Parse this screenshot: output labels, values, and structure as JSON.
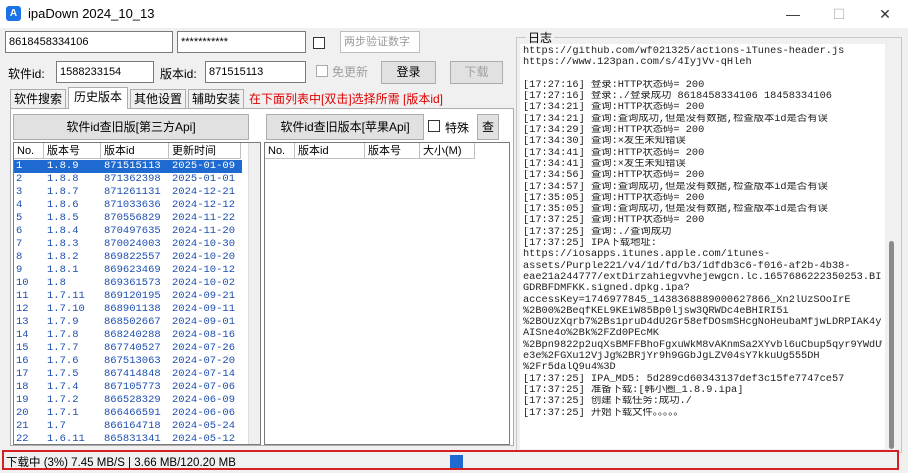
{
  "window": {
    "title": "ipaDown 2024_10_13",
    "icon_letter": "A",
    "minimize": "—",
    "maximize": "☐",
    "close": "✕"
  },
  "login": {
    "account": "8618458334106",
    "password": "***********",
    "twofa_placeholder": "两步验证数字",
    "software_id_label": "软件id:",
    "software_id": "1588233154",
    "version_id_label": "版本id:",
    "version_id": "871515113",
    "no_update_label": "免更新",
    "login_button": "登录",
    "download_button": "下载"
  },
  "tabs": [
    {
      "label": "软件搜索"
    },
    {
      "label": "历史版本"
    },
    {
      "label": "其他设置"
    },
    {
      "label": "辅助安装"
    }
  ],
  "hint": "在下面列表中[双击]选择所需 [版本id]",
  "left_panel": {
    "button": "软件id查旧版[第三方Api]",
    "columns": [
      "No.",
      "版本号",
      "版本id",
      "更新时间"
    ],
    "rows": [
      [
        "1",
        "1.8.9",
        "871515113",
        "2025-01-09"
      ],
      [
        "2",
        "1.8.8",
        "871362398",
        "2025-01-01"
      ],
      [
        "3",
        "1.8.7",
        "871261131",
        "2024-12-21"
      ],
      [
        "4",
        "1.8.6",
        "871033636",
        "2024-12-12"
      ],
      [
        "5",
        "1.8.5",
        "870556829",
        "2024-11-22"
      ],
      [
        "6",
        "1.8.4",
        "870497635",
        "2024-11-20"
      ],
      [
        "7",
        "1.8.3",
        "870024003",
        "2024-10-30"
      ],
      [
        "8",
        "1.8.2",
        "869822557",
        "2024-10-20"
      ],
      [
        "9",
        "1.8.1",
        "869623469",
        "2024-10-12"
      ],
      [
        "10",
        "1.8",
        "869361573",
        "2024-10-02"
      ],
      [
        "11",
        "1.7.11",
        "869120195",
        "2024-09-21"
      ],
      [
        "12",
        "1.7.10",
        "868901138",
        "2024-09-11"
      ],
      [
        "13",
        "1.7.9",
        "868502667",
        "2024-09-01"
      ],
      [
        "14",
        "1.7.8",
        "868240288",
        "2024-08-16"
      ],
      [
        "15",
        "1.7.7",
        "867740527",
        "2024-07-26"
      ],
      [
        "16",
        "1.7.6",
        "867513063",
        "2024-07-20"
      ],
      [
        "17",
        "1.7.5",
        "867414848",
        "2024-07-14"
      ],
      [
        "18",
        "1.7.4",
        "867105773",
        "2024-07-06"
      ],
      [
        "19",
        "1.7.2",
        "866528329",
        "2024-06-09"
      ],
      [
        "20",
        "1.7.1",
        "866466591",
        "2024-06-06"
      ],
      [
        "21",
        "1.7",
        "866164718",
        "2024-05-24"
      ],
      [
        "22",
        "1.6.11",
        "865831341",
        "2024-05-12"
      ]
    ]
  },
  "right_panel": {
    "button": "软件id查旧版本[苹果Api]",
    "special_label": "特殊",
    "query_button": "查",
    "columns": [
      "No.",
      "版本id",
      "版本号",
      "大小(M)"
    ]
  },
  "log": {
    "title": "日志",
    "lines": [
      "https://github.com/wf021325/actions-iTunes-header.js",
      "https://www.123pan.com/s/4IyjVv-qHleh",
      "",
      "[17:27:16] 登录:HTTP状态码= 200",
      "[17:27:16] 登录:./登录成功 8618458334106 18458334106",
      "[17:34:21] 查询:HTTP状态码= 200",
      "[17:34:21] 查询:查询成功,但是没有数据,检查版本id是否有误",
      "[17:34:29] 查询:HTTP状态码= 200",
      "[17:34:30] 查询:×发生未知错误",
      "[17:34:41] 查询:HTTP状态码= 200",
      "[17:34:41] 查询:×发生未知错误",
      "[17:34:56] 查询:HTTP状态码= 200",
      "[17:34:57] 查询:查询成功,但是没有数据,检查版本id是否有误",
      "[17:35:05] 查询:HTTP状态码= 200",
      "[17:35:05] 查询:查询成功,但是没有数据,检查版本id是否有误",
      "[17:37:25] 查询:HTTP状态码= 200",
      "[17:37:25] 查询:./查询成功",
      "[17:37:25] IPA下载地址:",
      "https://iosapps.itunes.apple.com/itunes-",
      "assets/Purple221/v4/1d/fd/b3/1dfdb3c6-f016-af2b-4b38-",
      "eae21a244777/extDirzahiegvvhejewgcn.lc.1657686222350253.BIE",
      "GDRBFDMFKK.signed.dpkg.ipa?",
      "accessKey=1746977845_1438368889000627866_Xn2lUzSOoIrE",
      "%2B00%2BeqfKEL9KEiW85Bp0ljsw3QRWDc4eBHIRI5i",
      "%2BOUzXqrb7%2Bs1pruD4dU2Gr58efDOsmSHcgNoHeubaMfjwLDRPIAK4yI",
      "AISne4o%2Bk%2FZd0PEcMK",
      "%2Bpn9822p2uqXsBMFFBhoFgxuWkM8vAKnmSa2XYvbl6uCbup5qyr9YWdUW",
      "e3e%2FGXu12VjJg%2BRjYr9h9GGbJgLZV04sY7kkuUg555DH",
      "%2Fr5dalQ9u4%3D",
      "[17:37:25] IPA_MD5: 5d289cd60343137def3c15fe7747ce57",
      "[17:37:25] 准备下载:[韩小圈_1.8.9.ipa]",
      "[17:37:25] 创建下载任务:成功./",
      "[17:37:25] 开始下载文件。。。。。"
    ]
  },
  "status": {
    "text": "下载中 (3%) 7.45 MB/S | 3.66 MB/120.20 MB",
    "progress_percent": 3
  },
  "colors": {
    "accent": "#1e6ad0",
    "hint_red": "#e00000",
    "status_border": "#d32020"
  }
}
